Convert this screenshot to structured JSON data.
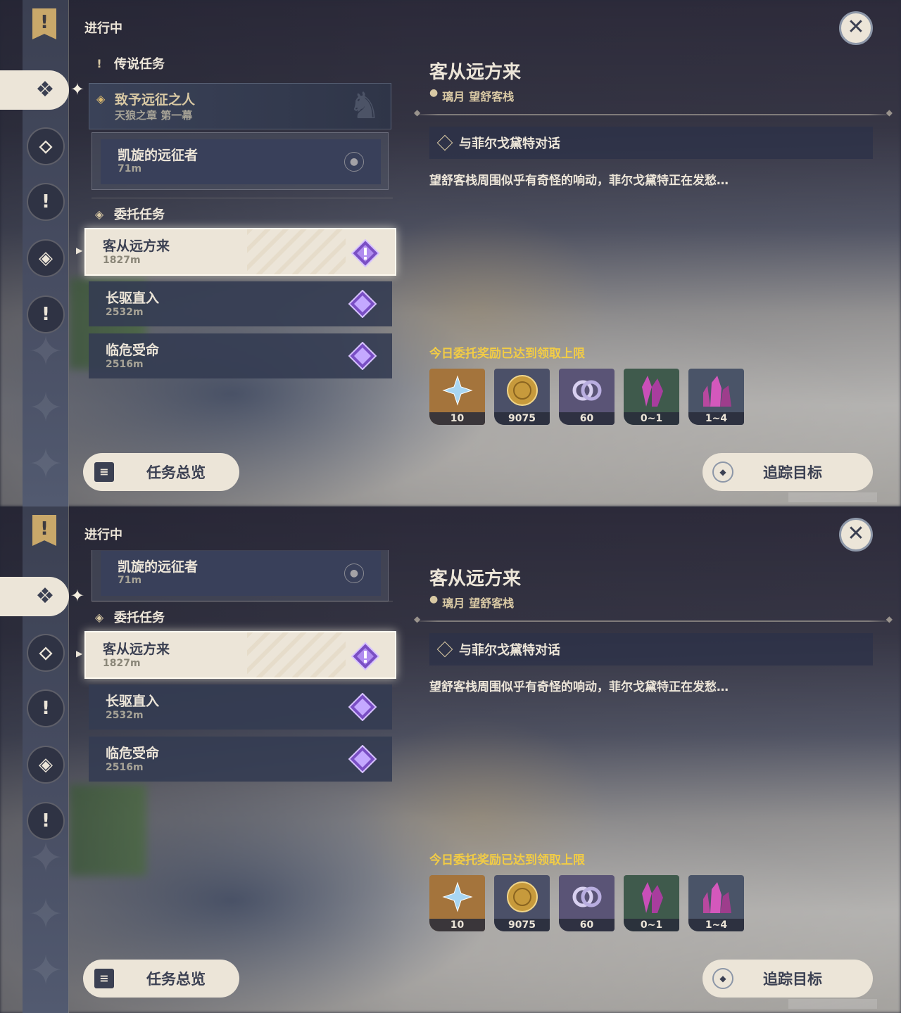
{
  "header": {
    "section_title": "进行中",
    "close_label": "✕"
  },
  "rail": {
    "items": [
      {
        "icon": "banner-icon",
        "glyph": "!"
      },
      {
        "icon": "commission-tab-icon",
        "glyph": "❖",
        "active": true
      },
      {
        "icon": "archon-quest-icon",
        "glyph": "⬦"
      },
      {
        "icon": "story-quest-icon",
        "glyph": "!"
      },
      {
        "icon": "world-quest-icon",
        "glyph": "◈"
      },
      {
        "icon": "event-quest-icon",
        "glyph": "!"
      }
    ]
  },
  "legend": {
    "category": "传说任务",
    "quest_title": "致予远征之人",
    "quest_chapter": "天狼之章 第一幕",
    "step_title": "凯旋的远征者",
    "step_distance": "71m"
  },
  "commissions": {
    "category": "委托任务",
    "items": [
      {
        "title": "客从远方来",
        "distance": "1827m",
        "active": true
      },
      {
        "title": "长驱直入",
        "distance": "2532m",
        "active": false
      },
      {
        "title": "临危受命",
        "distance": "2516m",
        "active": false
      }
    ]
  },
  "detail": {
    "title": "客从远方来",
    "region": "璃月",
    "location": "望舒客栈",
    "objective": "与菲尔戈黛特对话",
    "description": "望舒客栈周围似乎有奇怪的响动，菲尔戈黛特正在发愁…",
    "reward_note": "今日委托奖励已达到领取上限",
    "rewards": [
      {
        "name": "primogem-icon",
        "qty": "10",
        "bg": "#a4743c"
      },
      {
        "name": "mora-icon",
        "qty": "9075",
        "bg": "#4b5068"
      },
      {
        "name": "companionship-exp-icon",
        "qty": "60",
        "bg": "#5a5476"
      },
      {
        "name": "crystal-small-icon",
        "qty": "0~1",
        "bg": "#3f5a4c"
      },
      {
        "name": "crystal-large-icon",
        "qty": "1~4",
        "bg": "#4a5468"
      }
    ]
  },
  "buttons": {
    "overview": "任务总览",
    "track": "追踪目标"
  },
  "colors": {
    "accent_gold": "#d9c9a4",
    "reward_note_yellow": "#f2cc45",
    "cream": "#ece5d8",
    "quest_purple": "#a070e0"
  }
}
